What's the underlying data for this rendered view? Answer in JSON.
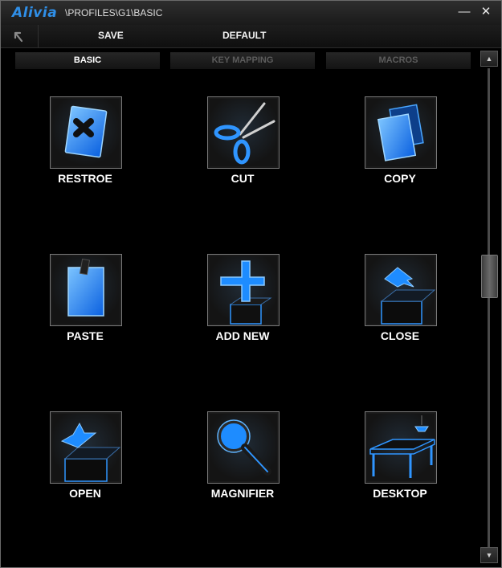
{
  "titlebar": {
    "logo": "Alivia",
    "path": "\\PROFILES\\G1\\BASIC",
    "minimize_glyph": "—",
    "close_glyph": "✕"
  },
  "toolbar": {
    "back_icon": "back-arrow-icon",
    "save_label": "SAVE",
    "default_label": "DEFAULT"
  },
  "tabs": [
    {
      "label": "BASIC",
      "active": true
    },
    {
      "label": "KEY MAPPING",
      "active": false
    },
    {
      "label": "MACROS",
      "active": false
    }
  ],
  "grid": {
    "items": [
      {
        "label": "RESTROE",
        "icon": "restore-icon"
      },
      {
        "label": "CUT",
        "icon": "scissors-icon"
      },
      {
        "label": "COPY",
        "icon": "copy-icon"
      },
      {
        "label": "PASTE",
        "icon": "paste-icon"
      },
      {
        "label": "ADD NEW",
        "icon": "add-new-icon"
      },
      {
        "label": "CLOSE",
        "icon": "close-box-icon"
      },
      {
        "label": "OPEN",
        "icon": "open-box-icon"
      },
      {
        "label": "MAGNIFIER",
        "icon": "magnifier-icon"
      },
      {
        "label": "DESKTOP",
        "icon": "desktop-icon"
      }
    ]
  },
  "scrollbar": {
    "up_glyph": "▲",
    "down_glyph": "▼"
  },
  "colors": {
    "accent": "#1e90ff",
    "glow": "#3aa0ff",
    "background": "#000000"
  }
}
